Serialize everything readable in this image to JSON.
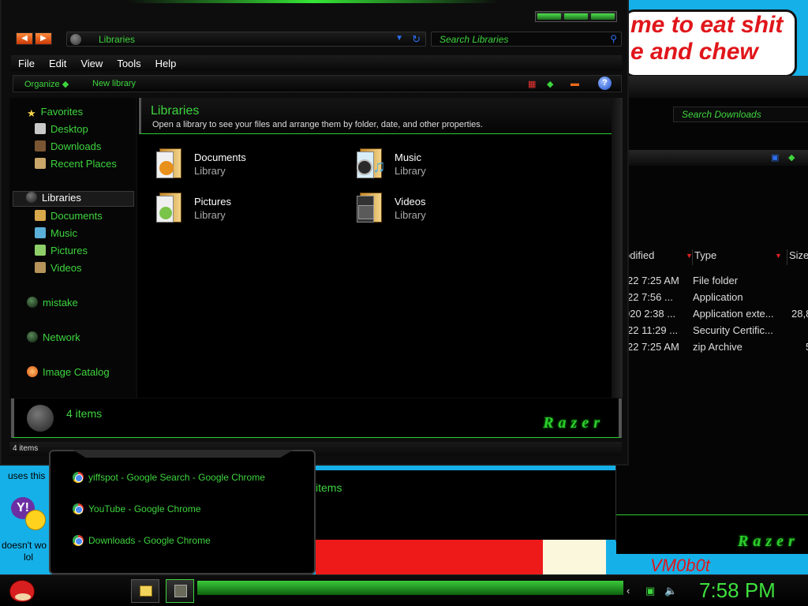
{
  "desktop": {
    "meme_line1": "me to eat shit",
    "meme_line2": "e and chew",
    "left_text1": "uses this",
    "left_text2": "doesn't wo",
    "left_text3": "lol",
    "bottom_text": "VM0b0t"
  },
  "second_window": {
    "search_placeholder": "Search Downloads",
    "columns": [
      "odified",
      "Type",
      "Size"
    ],
    "rows": [
      {
        "modified": "22 7:25 AM",
        "type": "File folder",
        "size": ""
      },
      {
        "modified": "22 7:56 ...",
        "type": "Application",
        "size": ""
      },
      {
        "modified": "020 2:38 ...",
        "type": "Application exte...",
        "size": "28,8"
      },
      {
        "modified": "22 11:29 ...",
        "type": "Security Certific...",
        "size": ""
      },
      {
        "modified": "22 7:25 AM",
        "type": "zip Archive",
        "size": "5"
      }
    ],
    "items_text": "items",
    "brand": "Razer"
  },
  "explorer": {
    "address": "Libraries",
    "search_placeholder": "Search Libraries",
    "menu": [
      "File",
      "Edit",
      "View",
      "Tools",
      "Help"
    ],
    "commands": {
      "organize": "Organize ◆",
      "new_library": "New library"
    },
    "nav": {
      "favorites": "Favorites",
      "desktop": "Desktop",
      "downloads": "Downloads",
      "recent": "Recent Places",
      "libraries": "Libraries",
      "documents": "Documents",
      "music": "Music",
      "pictures": "Pictures",
      "videos": "Videos",
      "mistake": "mistake",
      "network": "Network",
      "image_catalog": "Image Catalog"
    },
    "header": {
      "title": "Libraries",
      "subtitle": "Open a library to see your files and arrange them by folder, date, and other properties."
    },
    "libraries": [
      {
        "name": "Documents",
        "kind": "Library"
      },
      {
        "name": "Music",
        "kind": "Library"
      },
      {
        "name": "Pictures",
        "kind": "Library"
      },
      {
        "name": "Videos",
        "kind": "Library"
      }
    ],
    "details_count": "4 items",
    "status": "4 items",
    "brand": "Razer"
  },
  "jumplist": [
    "yiffspot - Google Search - Google Chrome",
    "YouTube - Google Chrome",
    "Downloads - Google Chrome"
  ],
  "taskbar": {
    "clock": "7:58 PM"
  },
  "colors": {
    "accent": "#3ed43e",
    "link_blue": "#2c6ff0"
  }
}
